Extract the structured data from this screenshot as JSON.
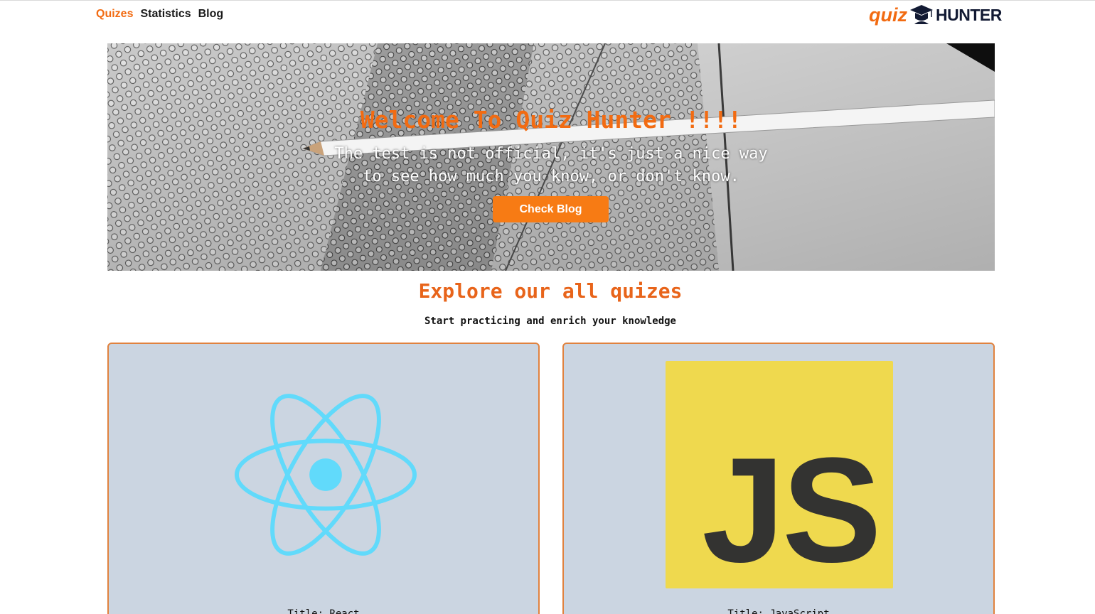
{
  "nav": {
    "items": [
      {
        "label": "Quizes",
        "active": true
      },
      {
        "label": "Statistics",
        "active": false
      },
      {
        "label": "Blog",
        "active": false
      }
    ]
  },
  "logo": {
    "quiz": "quiz",
    "hunter": "HUNTER",
    "icon": "graduation-cap-icon"
  },
  "hero": {
    "title": "Welcome To Quiz Hunter !!!!",
    "subtitle": "The test is not official, it's just a nice way to see how much you know, or don't know.",
    "button_label": "Check Blog"
  },
  "section": {
    "title": "Explore our all quizes",
    "subtitle": "Start practicing and enrich your knowledge"
  },
  "quizzes": [
    {
      "icon": "react-logo-icon",
      "title": "Title: React"
    },
    {
      "icon": "javascript-logo-icon",
      "js_label": "JS",
      "title": "Title: JavaScript"
    }
  ],
  "colors": {
    "accent": "#f26b12",
    "button": "#f77b14",
    "card_bg": "#cbd5e1",
    "card_border": "#e0823f",
    "react": "#61dafb",
    "js_yellow": "#efd94e",
    "logo_dark": "#121a33"
  }
}
